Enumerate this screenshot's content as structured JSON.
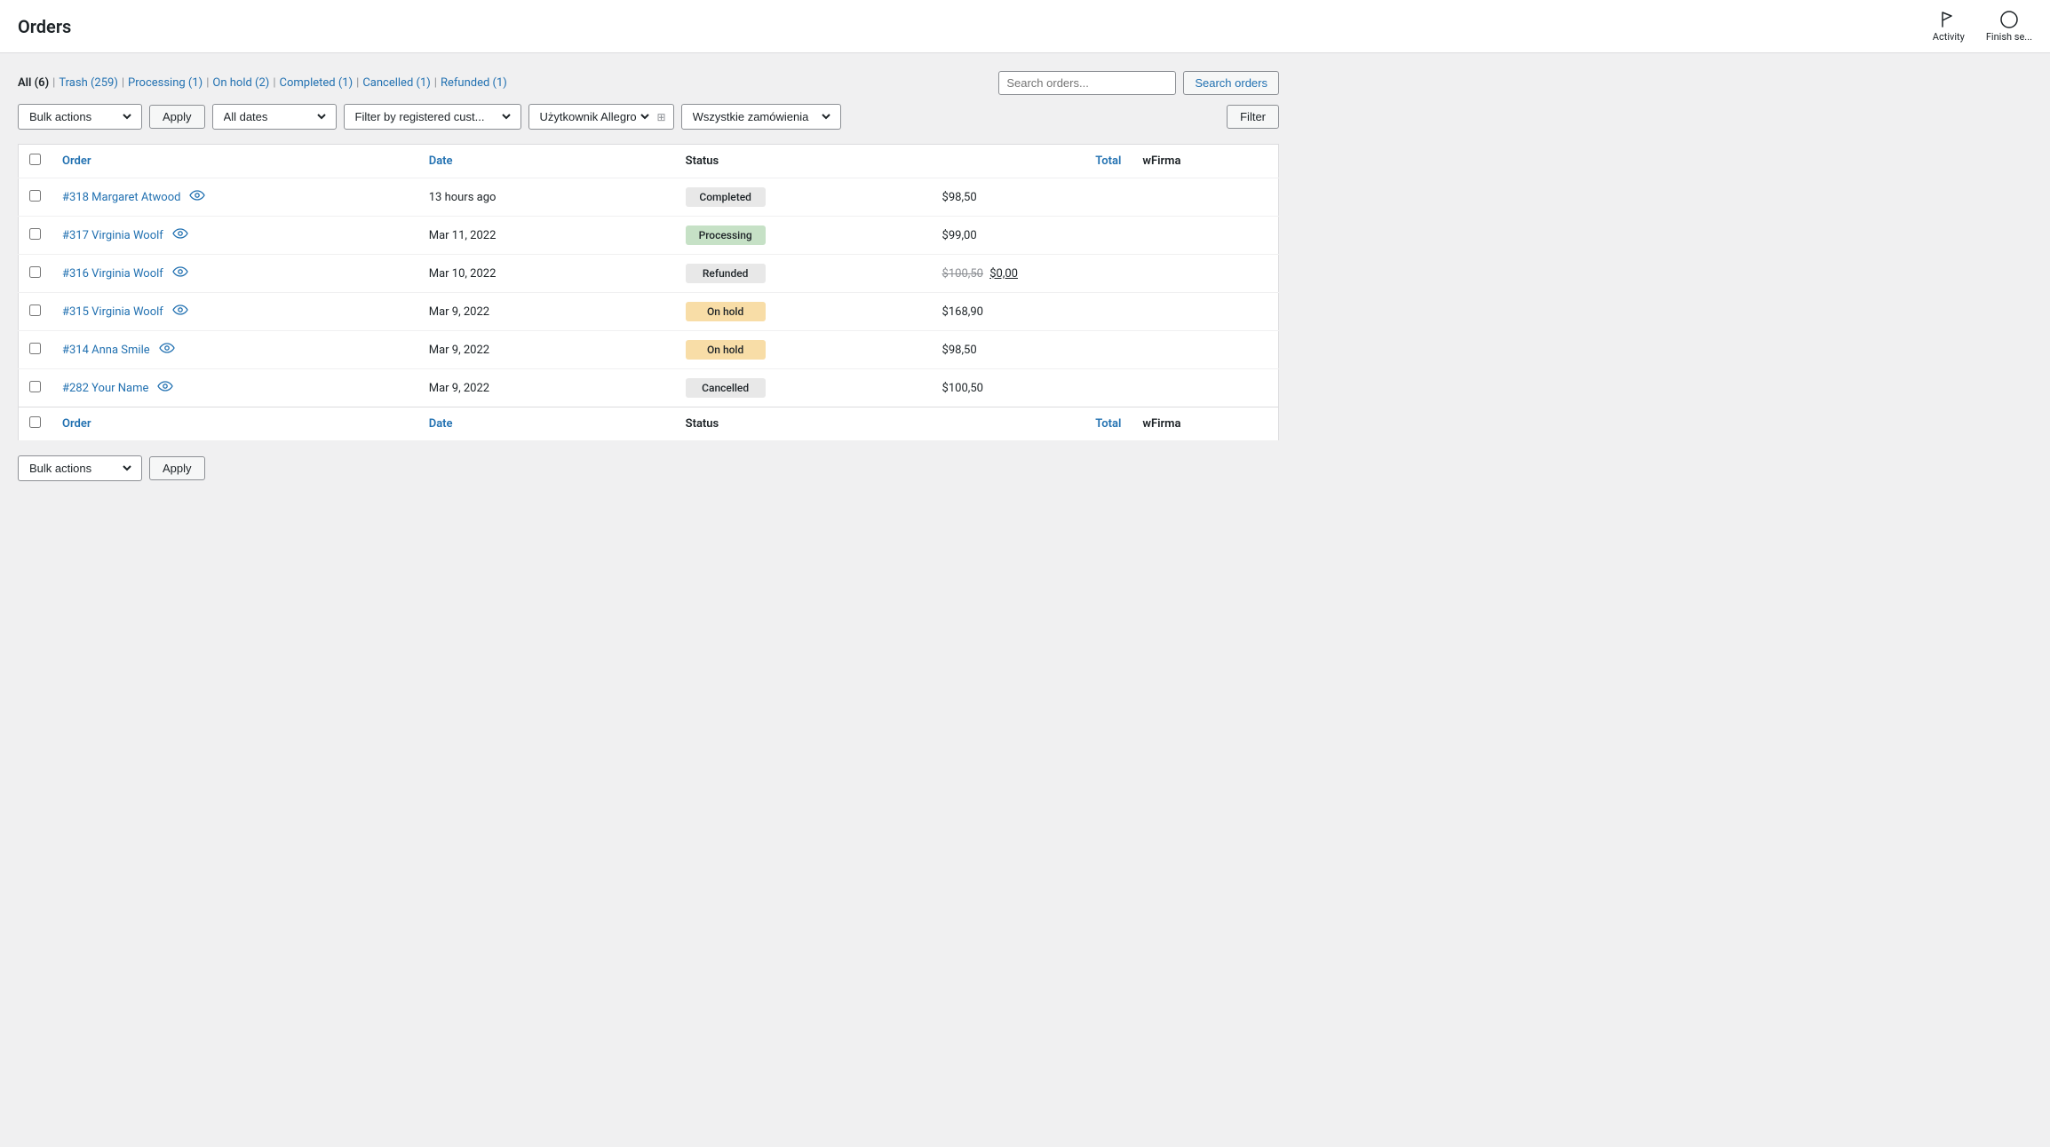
{
  "page": {
    "title": "Orders"
  },
  "topbar": {
    "activity_label": "Activity",
    "finish_setup_label": "Finish se..."
  },
  "filter_tabs": [
    {
      "key": "all",
      "label": "All",
      "count": "6",
      "active": true
    },
    {
      "key": "trash",
      "label": "Trash",
      "count": "259",
      "active": false
    },
    {
      "key": "processing",
      "label": "Processing",
      "count": "1",
      "active": false
    },
    {
      "key": "on_hold",
      "label": "On hold",
      "count": "2",
      "active": false
    },
    {
      "key": "completed",
      "label": "Completed",
      "count": "1",
      "active": false
    },
    {
      "key": "cancelled",
      "label": "Cancelled",
      "count": "1",
      "active": false
    },
    {
      "key": "refunded",
      "label": "Refunded",
      "count": "1",
      "active": false
    }
  ],
  "toolbar": {
    "bulk_actions_label": "Bulk actions",
    "apply_label": "Apply",
    "all_dates_label": "All dates",
    "filter_customer_placeholder": "Filter by registered cust...",
    "allegro_user_label": "Użytkownik Allegro",
    "all_orders_label": "Wszystkie zamówienia",
    "filter_btn_label": "Filter",
    "search_placeholder": "Search orders..."
  },
  "table": {
    "col_order": "Order",
    "col_date": "Date",
    "col_status": "Status",
    "col_total": "Total",
    "col_wfirma": "wFirma"
  },
  "orders": [
    {
      "id": "#318",
      "name": "Margaret Atwood",
      "date": "13 hours ago",
      "status": "Completed",
      "status_key": "completed",
      "total": "$98,50",
      "total_original": null,
      "total_zero": null,
      "wfirma": ""
    },
    {
      "id": "#317",
      "name": "Virginia Woolf",
      "date": "Mar 11, 2022",
      "status": "Processing",
      "status_key": "processing",
      "total": "$99,00",
      "total_original": null,
      "total_zero": null,
      "wfirma": ""
    },
    {
      "id": "#316",
      "name": "Virginia Woolf",
      "date": "Mar 10, 2022",
      "status": "Refunded",
      "status_key": "refunded",
      "total": "$0,00",
      "total_original": "$100,50",
      "total_zero": "$0,00",
      "wfirma": ""
    },
    {
      "id": "#315",
      "name": "Virginia Woolf",
      "date": "Mar 9, 2022",
      "status": "On hold",
      "status_key": "onhold",
      "total": "$168,90",
      "total_original": null,
      "total_zero": null,
      "wfirma": ""
    },
    {
      "id": "#314",
      "name": "Anna Smile",
      "date": "Mar 9, 2022",
      "status": "On hold",
      "status_key": "onhold",
      "total": "$98,50",
      "total_original": null,
      "total_zero": null,
      "wfirma": ""
    },
    {
      "id": "#282",
      "name": "Your Name",
      "date": "Mar 9, 2022",
      "status": "Cancelled",
      "status_key": "cancelled",
      "total": "$100,50",
      "total_original": null,
      "total_zero": null,
      "wfirma": ""
    }
  ]
}
